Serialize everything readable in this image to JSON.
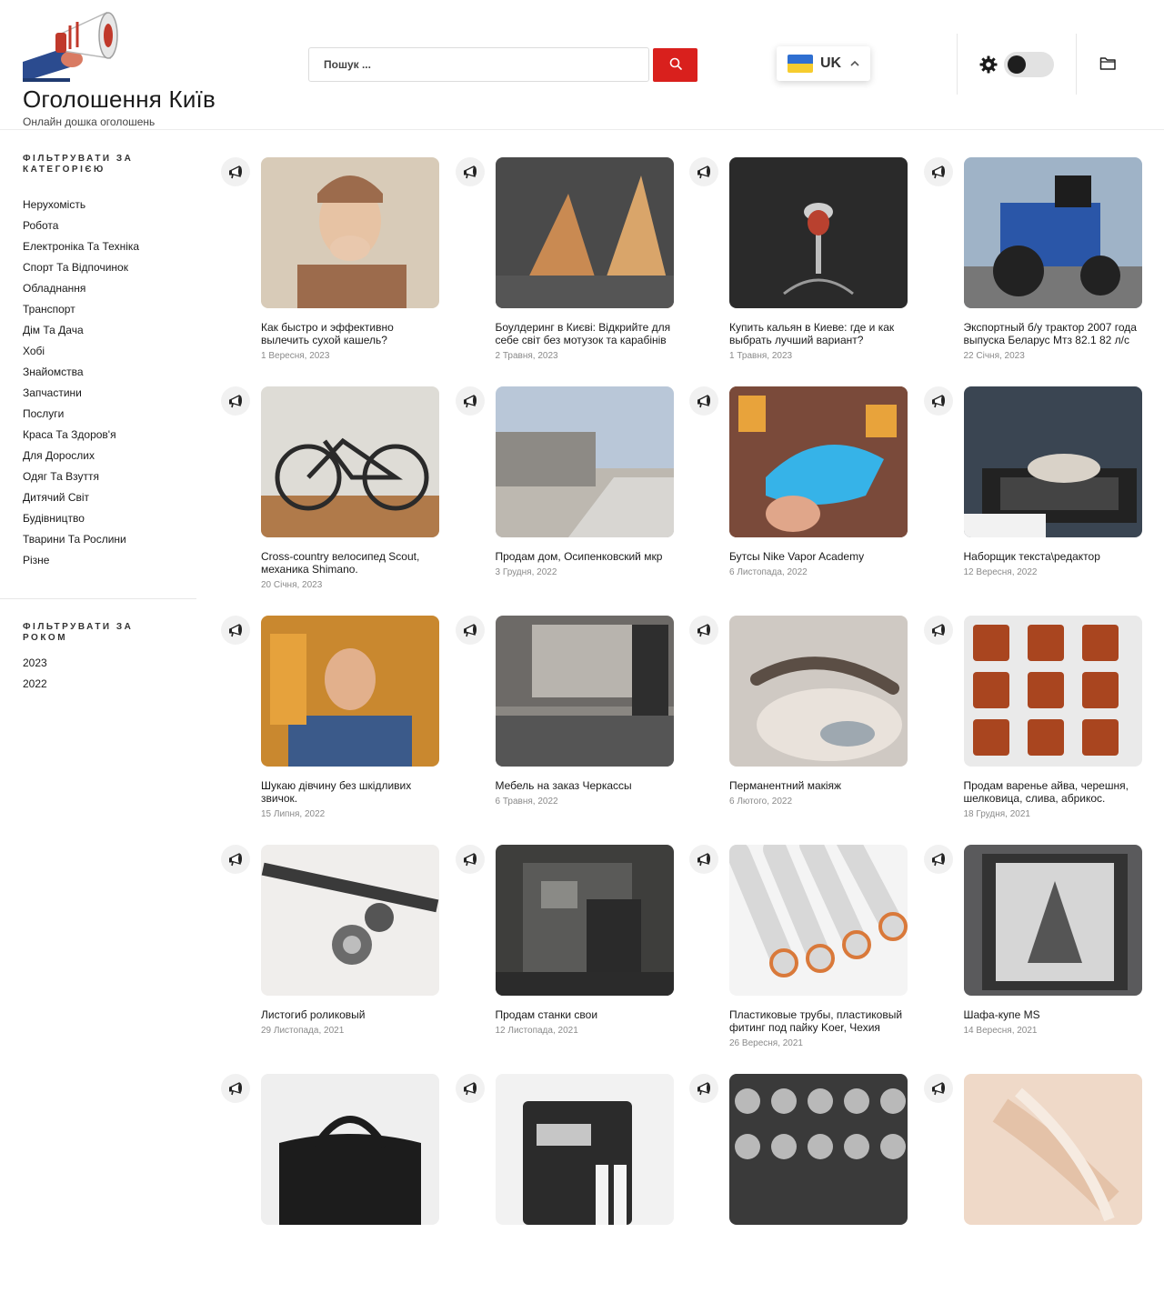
{
  "site": {
    "title": "Оголошення Київ",
    "tagline": "Онлайн дошка оголошень",
    "logo_icon": "megaphone-logo-icon"
  },
  "search": {
    "placeholder": "Пошук ...",
    "button_icon": "search-icon",
    "button_color": "#d9201d"
  },
  "language": {
    "label": "UK",
    "flag_icon": "ukraine-flag-icon",
    "chevron_icon": "chevron-up-icon"
  },
  "toolbar": {
    "settings_icon": "gear-icon",
    "theme_toggle_state": "off",
    "folder_icon": "folder-icon"
  },
  "sidebar": {
    "category_filter_title": "ФІЛЬТРУВАТИ ЗА КАТЕГОРІЄЮ",
    "categories": [
      "Нерухомість",
      "Робота",
      "Електроніка Та Техніка",
      "Спорт Та Відпочинок",
      "Обладнання",
      "Транспорт",
      "Дім Та Дача",
      "Хобі",
      "Знайомства",
      "Запчастини",
      "Послуги",
      "Краса Та Здоров'я",
      "Для Дорослих",
      "Одяг Та Взуття",
      "Дитячий Світ",
      "Будівництво",
      "Тварини Та Рослини",
      "Різне"
    ],
    "year_filter_title": "ФІЛЬТРУВАТИ ЗА РОКОМ",
    "years": [
      "2023",
      "2022"
    ]
  },
  "listings": [
    {
      "title": "Как быстро и эффективно вылечить сухой кашель?",
      "date": "1 Вересня, 2023",
      "lines": 2,
      "photo": "man-coughing-photo",
      "bg": "#d8cbb8",
      "fg": "#9c6b4c"
    },
    {
      "title": "Боулдеринг в Києві: Відкрийте для себе світ без мотузок та карабінів",
      "date": "2 Травня, 2023",
      "lines": 2,
      "photo": "climbing-gym-photo",
      "bg": "#4a4a4a",
      "fg": "#c98a52"
    },
    {
      "title": "Купить кальян в Киеве: где и как выбрать лучший вариант?",
      "date": "1 Травня, 2023",
      "lines": 2,
      "photo": "hookah-photo",
      "bg": "#2a2a2a",
      "fg": "#b9412f"
    },
    {
      "title": "Экспортный б/у трактор 2007 года выпуска Беларус Мтз 82.1 82 л/с",
      "date": "22 Січня, 2023",
      "lines": 2,
      "photo": "tractor-photo",
      "bg": "#9fb3c7",
      "fg": "#2a56a8"
    },
    {
      "title": "Cross-country велосипед Scout, механика Shimano.",
      "date": "20 Січня, 2023",
      "lines": 2,
      "photo": "bicycle-photo",
      "bg": "#dedcd6",
      "fg": "#2a2a2a"
    },
    {
      "title": "Продам дом, Осипенковский мкр",
      "date": "3 Грудня, 2022",
      "lines": 1,
      "photo": "street-house-photo",
      "bg": "#b9c7d8",
      "fg": "#8d8a85"
    },
    {
      "title": "Бутсы Nike Vapor Academy",
      "date": "6 Листопада, 2022",
      "lines": 1,
      "photo": "football-boots-photo",
      "bg": "#7a4a3a",
      "fg": "#36b3e8"
    },
    {
      "title": "Наборщик текста\\редактор",
      "date": "12 Вересня, 2022",
      "lines": 1,
      "photo": "typing-laptop-photo",
      "bg": "#3a4552",
      "fg": "#d9d2c8"
    },
    {
      "title": "Шукаю дівчину без шкідливих звичок.",
      "date": "15 Липня, 2022",
      "lines": 2,
      "photo": "man-portrait-photo",
      "bg": "#c9882f",
      "fg": "#3b5a8a"
    },
    {
      "title": "Мебель на заказ Черкассы",
      "date": "6 Травня, 2022",
      "lines": 1,
      "photo": "kitchen-photo",
      "bg": "#6d6a67",
      "fg": "#b8b4ae"
    },
    {
      "title": "Перманентний макіяж",
      "date": "6 Лютого, 2022",
      "lines": 1,
      "photo": "eyebrow-closeup-photo",
      "bg": "#cfc9c3",
      "fg": "#5b4e45"
    },
    {
      "title": "Продам варенье айва, черешня, шелковица, слива, абрикос.",
      "date": "18 Грудня, 2021",
      "lines": 2,
      "photo": "jam-jars-photo",
      "bg": "#eaeaea",
      "fg": "#a9451f"
    },
    {
      "title": "Листогиб роликовый",
      "date": "29 Листопада, 2021",
      "lines": 1,
      "photo": "roller-bender-photo",
      "bg": "#f0eeec",
      "fg": "#3a3a3a"
    },
    {
      "title": "Продам станки свои",
      "date": "12 Листопада, 2021",
      "lines": 1,
      "photo": "machine-tools-photo",
      "bg": "#3e3e3c",
      "fg": "#8a8a86"
    },
    {
      "title": "Пластиковые трубы, пластиковый фитинг под пайку Koer, Чехия",
      "date": "26 Вересня, 2021",
      "lines": 2,
      "photo": "plastic-pipes-photo",
      "bg": "#f4f4f4",
      "fg": "#d9793a"
    },
    {
      "title": "Шафа-купе MS",
      "date": "14 Вересня, 2021",
      "lines": 1,
      "photo": "wardrobe-photo",
      "bg": "#5a5a5c",
      "fg": "#d6d6d6"
    },
    {
      "title": "",
      "date": "",
      "lines": 0,
      "photo": "leather-bag-photo",
      "bg": "#efefef",
      "fg": "#1c1c1c"
    },
    {
      "title": "",
      "date": "",
      "lines": 0,
      "photo": "battery-charger-photo",
      "bg": "#f2f2f2",
      "fg": "#2b2b2b"
    },
    {
      "title": "",
      "date": "",
      "lines": 0,
      "photo": "helmets-shelf-photo",
      "bg": "#3a3a3a",
      "fg": "#b9b9b9"
    },
    {
      "title": "",
      "date": "",
      "lines": 0,
      "photo": "beige-fabric-photo",
      "bg": "#efd9c8",
      "fg": "#e4c2a8"
    }
  ]
}
